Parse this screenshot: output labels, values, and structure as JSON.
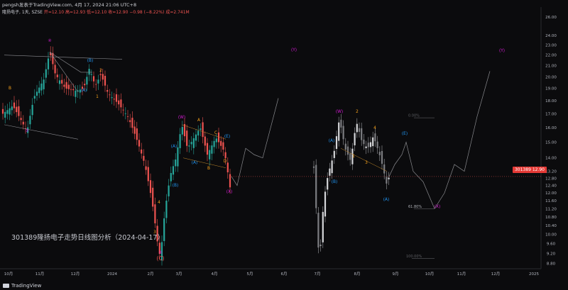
{
  "header": {
    "publisher_line": "pengsh发表于TradingView.com, 4月 17, 2024 21:06 UTC+8",
    "symbol_line": "隆扬电子, 1天, SZSE",
    "ohlc": "开=12.10  高=12.93  低=12.10  收=12.90 −0.98 (−8.22%)",
    "volume": "成=2.741M"
  },
  "annotation": "301389隆扬电子走势日线图分析（2024-04-17）",
  "footer": {
    "brand": "TradingView",
    "logo_icon": "tradingview-logo-icon"
  },
  "price_tag": {
    "symbol": "301389",
    "price": "12.90"
  },
  "colors": {
    "up": "#26a69a",
    "down": "#ef5350",
    "ghost": "#8a8b8f",
    "wave_primary": "#d81bd8",
    "wave_minor": "#2196f3",
    "wave_sub": "#f7a21b",
    "background": "#0b0b0d"
  },
  "chart_data": {
    "type": "candlestick",
    "title": "",
    "x_tick_labels": [
      "10月",
      "11月",
      "12月",
      "2024",
      "2月",
      "3月",
      "4月",
      "5月",
      "6月",
      "7月",
      "8月",
      "9月",
      "10月",
      "11月",
      "12月",
      "2025"
    ],
    "y_tick_labels": [
      "8.80",
      "9.20",
      "9.60",
      "10.00",
      "10.40",
      "10.80",
      "11.20",
      "11.60",
      "12.00",
      "12.40",
      "12.80",
      "13.20",
      "14.00",
      "15.00",
      "16.00",
      "17.00",
      "18.00",
      "19.00",
      "20.00",
      "21.00",
      "22.00",
      "23.00",
      "24.00",
      "26.00"
    ],
    "y_scale": "log",
    "ylim": [
      8.6,
      26.5
    ],
    "current_price": 12.9,
    "real_candles_approx": [
      {
        "period": "2023-10",
        "low": 16.5,
        "high": 18.5
      },
      {
        "period": "2023-11 peak",
        "high": 22.3
      },
      {
        "period": "2024-02 low",
        "low": 9.0
      },
      {
        "period": "2024-03 (W)",
        "high": 16.2
      },
      {
        "period": "2024-04-17",
        "open": 12.1,
        "high": 12.93,
        "low": 12.1,
        "close": 12.9
      }
    ],
    "wave_labels": [
      {
        "text": "B",
        "price": 18.8,
        "color": "sub"
      },
      {
        "text": "③",
        "price": 15.7,
        "color": "primary"
      },
      {
        "text": "④",
        "price": 23.5,
        "color": "primary"
      },
      {
        "text": "(A)",
        "price": 19.0,
        "color": "minor"
      },
      {
        "text": "(B)",
        "price": 20.8,
        "color": "minor"
      },
      {
        "text": "2",
        "price": 20.2,
        "color": "sub"
      },
      {
        "text": "1",
        "price": 18.4,
        "color": "sub"
      },
      {
        "text": "(W)",
        "price": 16.4,
        "color": "primary"
      },
      {
        "text": "A",
        "price": 16.0,
        "color": "sub"
      },
      {
        "text": "C",
        "price": 15.2,
        "color": "sub"
      },
      {
        "text": "(E)",
        "price": 14.9,
        "color": "minor"
      },
      {
        "text": "(A)",
        "price": 14.2,
        "color": "minor"
      },
      {
        "text": "(A)",
        "price": 13.4,
        "color": "minor"
      },
      {
        "text": "D",
        "price": 13.4,
        "color": "sub"
      },
      {
        "text": "B",
        "price": 13.1,
        "color": "sub"
      },
      {
        "text": "(B)",
        "price": 12.5,
        "color": "minor"
      },
      {
        "text": "(X)",
        "price": 12.2,
        "color": "primary"
      },
      {
        "text": "3",
        "price": 10.0,
        "color": "sub"
      },
      {
        "text": "4",
        "price": 11.2,
        "color": "sub"
      },
      {
        "text": "⑤",
        "price": 8.8,
        "color": "primary"
      },
      {
        "text": "(C)",
        "price": 8.6,
        "color": "down"
      },
      {
        "text": "(Y)",
        "price": 22.0,
        "color": "primary"
      },
      {
        "text": "(W)",
        "price": 16.8,
        "color": "primary"
      },
      {
        "text": "(A)",
        "price": 14.3,
        "color": "minor"
      },
      {
        "text": "(B)",
        "price": 12.6,
        "color": "minor"
      },
      {
        "text": "2",
        "price": 16.8,
        "color": "sub"
      },
      {
        "text": "4",
        "price": 15.2,
        "color": "sub"
      },
      {
        "text": "1",
        "price": 13.8,
        "color": "sub"
      },
      {
        "text": "3",
        "price": 13.4,
        "color": "sub"
      },
      {
        "text": "(E)",
        "price": 15.0,
        "color": "minor"
      },
      {
        "text": "(A)",
        "price": 11.6,
        "color": "minor"
      },
      {
        "text": "(X)",
        "price": 11.0,
        "color": "primary"
      },
      {
        "text": "(Y)",
        "price": 22.0,
        "color": "primary"
      }
    ],
    "fib_levels": [
      {
        "label": "0.00%",
        "price": 16.7
      },
      {
        "label": "61.80%",
        "price": 11.2
      },
      {
        "label": "100.00%",
        "price": 9.0
      }
    ]
  }
}
